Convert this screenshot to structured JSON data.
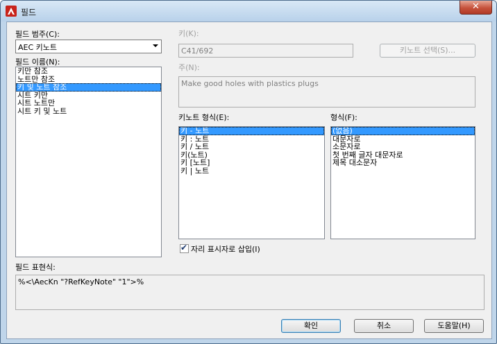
{
  "window": {
    "title": "필드",
    "close_label": "✕"
  },
  "category": {
    "label": "필드 범주(C):",
    "value": "AEC 키노트"
  },
  "field_names": {
    "label": "필드 이름(N):",
    "items": [
      "키만 참조",
      "노트만 참조",
      "키 및 노트 참조",
      "시트 키만",
      "시트 노트만",
      "시트 키 및 노트"
    ],
    "selected_index": 2
  },
  "key": {
    "label": "키(K):",
    "value": "C41/692"
  },
  "keynote_select_button": "키노트 선택(S)...",
  "note": {
    "label": "주(N):",
    "value": "Make good holes with plastics plugs"
  },
  "keynote_format": {
    "label": "키노트 형식(E):",
    "items": [
      "키 - 노트",
      "키 : 노트",
      "키 / 노트",
      "키(노트)",
      "키 [노트]",
      "키 | 노트"
    ],
    "selected_index": 0
  },
  "format": {
    "label": "형식(F):",
    "items": [
      "(없음)",
      "대문자로",
      "소문자로",
      "첫 번째 글자 대문자로",
      "제목 대소문자"
    ],
    "selected_index": 0
  },
  "placeholder_checkbox": {
    "label": "자리 표시자로 삽입(I)",
    "checked": true
  },
  "field_expression": {
    "label": "필드 표현식:",
    "value": "%<\\AecKn \"?RefKeyNote\" \"1\">%"
  },
  "buttons": {
    "ok": "확인",
    "cancel": "취소",
    "help": "도움말(H)"
  },
  "colors": {
    "selection": "#3399ff",
    "title_bar": "#bfd5ea",
    "close_button": "#c6523c"
  }
}
